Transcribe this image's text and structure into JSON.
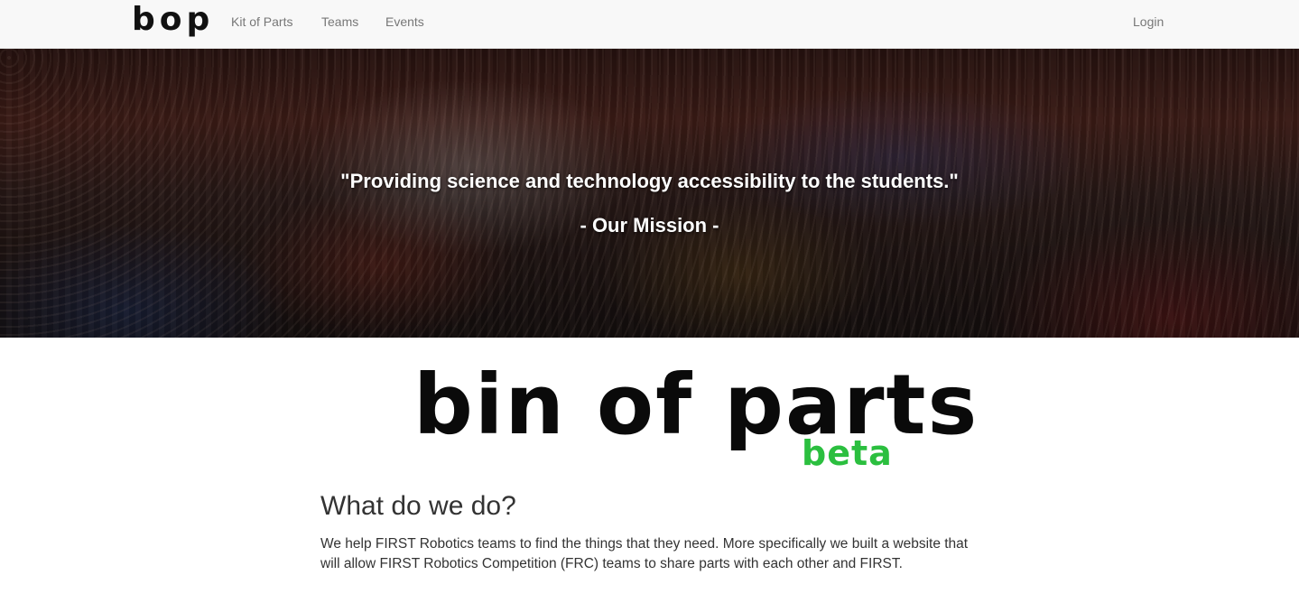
{
  "navbar": {
    "brand": "bop",
    "links": [
      "Kit of Parts",
      "Teams",
      "Events"
    ],
    "login": "Login"
  },
  "hero": {
    "quote": "\"Providing science and technology accessibility to the students.\"",
    "subtitle": "- Our Mission -"
  },
  "logo": {
    "main": "bin of parts",
    "badge": "beta",
    "badge_color": "#2bbf3f"
  },
  "about": {
    "heading": "What do we do?",
    "body": "We help FIRST Robotics teams to find the things that they need. More specifically we built a website that will allow FIRST Robotics Competition (FRC) teams to share parts with each other and FIRST."
  }
}
